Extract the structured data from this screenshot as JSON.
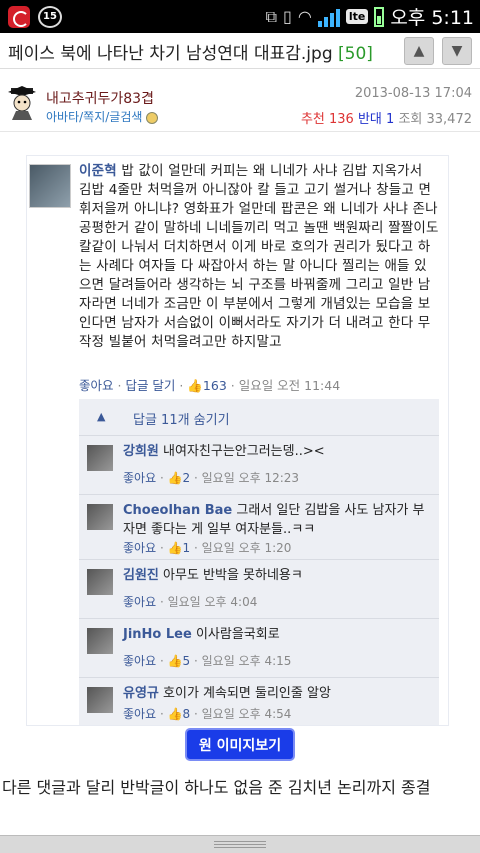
{
  "status_bar": {
    "icons": [
      "app-icon",
      "age-rating-icon"
    ],
    "age_label": "15",
    "right_icons": [
      "screen-mirror-icon",
      "vibrate-icon",
      "wifi-icon",
      "signal-icon",
      "lte-icon",
      "battery-icon"
    ],
    "lte_label": "lte",
    "time": "오후 5:11"
  },
  "titlebar": {
    "title": "페이스 북에 나타난 차기 남성연대 대표감.jpg ",
    "count": "[50]",
    "up_label": "▲",
    "down_label": "▼"
  },
  "post": {
    "author": "내고추귀두가83겹",
    "author_links": "아바타/쪽지/글검색",
    "date": "2013-08-13 17:04",
    "recommend_label": "추천 ",
    "recommend_count": "136",
    "oppose_label": " 반대 ",
    "oppose_count": "1",
    "views_label": " 조회 ",
    "views_count": "33,472"
  },
  "fb": {
    "main_name": "이준혁",
    "main_text": " 밥 값이 얼만데 커피는 왜 니네가 사냐 김밥 지옥가서 김밥 4줄만 처먹을꺼 아니잖아 칼 들고 고기 썰거나 창들고 면 휘저을꺼 아니냐? 영화표가 얼만데 팝콘은 왜 니네가 사냐 존나 공평한거 같이 말하네 니네들끼리 먹고 놀땐 백원짜리 짤짤이도 칼같이 나눠서 더치하면서 이게 바로 호의가 권리가 됬다고 하는 사례다 여자들 다 싸잡아서 하는 말 아니다 찔리는 애들 있으면 달려들어라 생각하는 뇌 구조를 바꿔줄께 그리고 일반 남자라면 너네가 조금만 이 부분에서 그렇게 개념있는 모습을 보인다면 남자가 서슴없이 이뻐서라도 자기가 더 내려고 한다 무작정 빌붙어 처먹을려고만 하지말고",
    "main_like": "좋아요",
    "main_reply": "답글 달기",
    "main_likes": "163",
    "main_time": "일요일 오전 11:44",
    "hide_replies": "답글 11개 숨기기",
    "replies": [
      {
        "name": "강희원",
        "text": " 내여자친구는안그러는뎅..><",
        "likes": "2",
        "time": "일요일 오후 12:23"
      },
      {
        "name": "Choeolhan Bae",
        "text": " 그래서 일단 김밥을 사도 남자가 부자면 좋다는 게 일부 여자분들..ㅋㅋ",
        "likes": "1",
        "time": "일요일 오후 1:20"
      },
      {
        "name": "김원진",
        "text": " 아무도 반박을 못하네용ㅋ",
        "likes": "",
        "time": "일요일 오후 4:04"
      },
      {
        "name": "JinHo Lee",
        "text": " 이사람을국회로",
        "likes": "5",
        "time": "일요일 오후 4:15"
      },
      {
        "name": "유영규",
        "text": " 호이가 계속되면 둘리인줄 알앙",
        "likes": "8",
        "time": "일요일 오후 4:54"
      }
    ],
    "like_label": "좋아요"
  },
  "original_image_button": "원 이미지보기",
  "body_text": "다른 댓글과 달리 반박글이 하나도 없음 준 김치년 논리까지 종결"
}
